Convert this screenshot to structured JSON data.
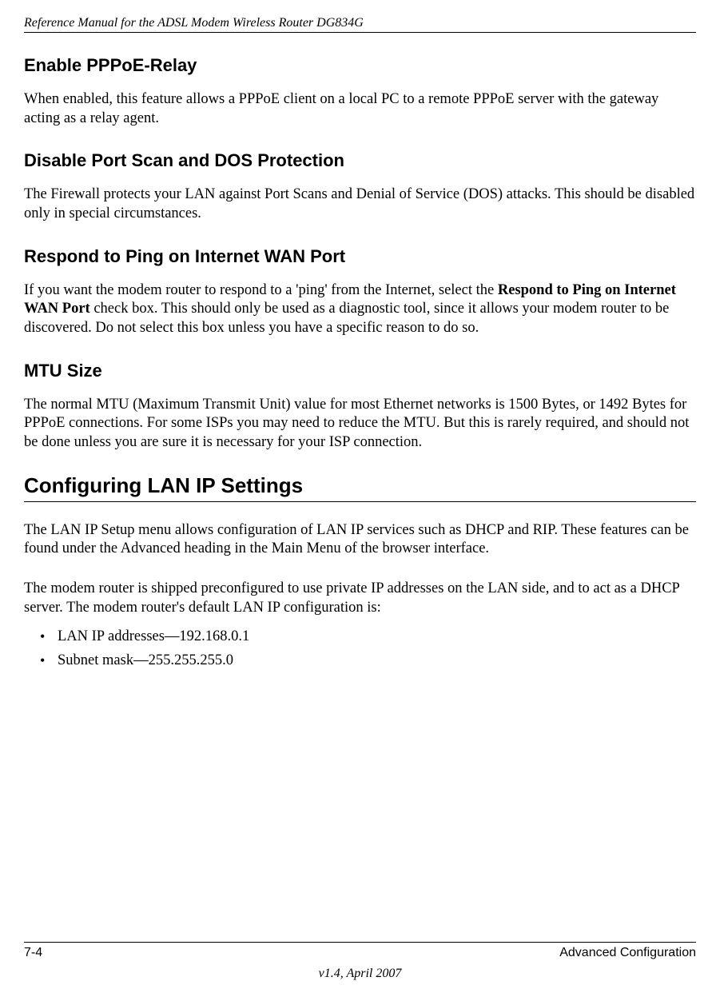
{
  "header": {
    "title": "Reference Manual for the ADSL Modem Wireless Router DG834G"
  },
  "sections": {
    "pppoeRelay": {
      "heading": "Enable PPPoE-Relay",
      "body": "When enabled, this feature allows a PPPoE client on a local PC to a remote PPPoE server with the gateway acting as a relay agent."
    },
    "portScan": {
      "heading": "Disable Port Scan and DOS Protection",
      "body": "The Firewall protects your LAN against Port Scans and Denial of Service (DOS) attacks. This should be disabled only in special circumstances."
    },
    "respondPing": {
      "heading": "Respond to Ping on Internet WAN Port",
      "body_pre": "If you want the modem router to respond to a 'ping' from the Internet, select the ",
      "body_bold": "Respond to Ping on Internet WAN Port",
      "body_post": " check box. This should only be used as a diagnostic tool, since it allows your modem router to be discovered. Do not select this box unless you have a specific reason to do so."
    },
    "mtu": {
      "heading": "MTU Size",
      "body": "The normal MTU (Maximum Transmit Unit) value for most Ethernet networks is 1500 Bytes, or 1492 Bytes for PPPoE connections. For some ISPs you may need to reduce the MTU. But this is rarely required, and should not be done unless you are sure it is necessary for your ISP connection."
    },
    "lanIp": {
      "heading": "Configuring LAN IP Settings",
      "p1": "The LAN IP Setup menu allows configuration of LAN IP services such as DHCP and RIP. These features can be found under the Advanced heading in the Main Menu of the browser interface.",
      "p2": "The modem router is shipped preconfigured to use private IP addresses on the LAN side, and to act as a DHCP server. The modem router's default LAN IP configuration is:",
      "bullets": [
        "LAN IP addresses—192.168.0.1",
        "Subnet mask—255.255.255.0"
      ]
    }
  },
  "footer": {
    "pageNum": "7-4",
    "chapter": "Advanced Configuration",
    "version": "v1.4, April 2007"
  }
}
